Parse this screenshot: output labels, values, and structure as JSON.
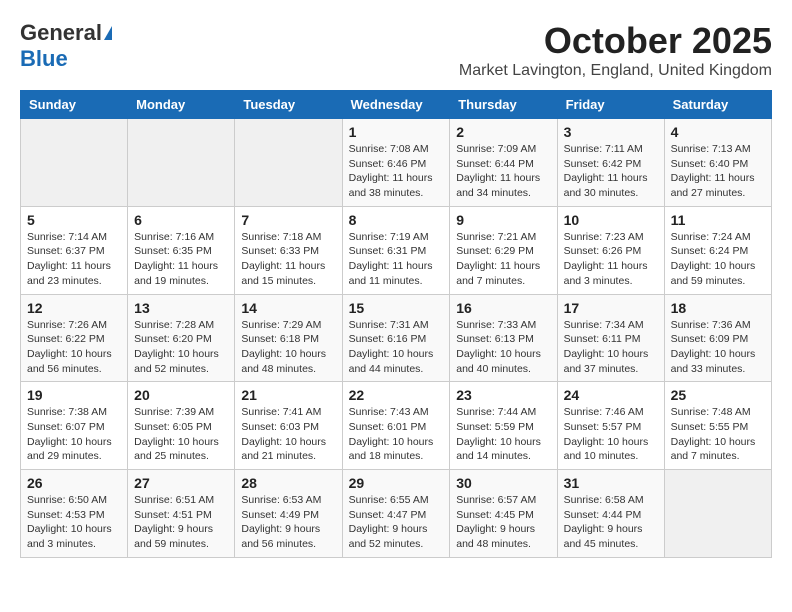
{
  "header": {
    "logo_general": "General",
    "logo_blue": "Blue",
    "month_title": "October 2025",
    "location": "Market Lavington, England, United Kingdom"
  },
  "weekdays": [
    "Sunday",
    "Monday",
    "Tuesday",
    "Wednesday",
    "Thursday",
    "Friday",
    "Saturday"
  ],
  "weeks": [
    [
      {
        "day": "",
        "info": ""
      },
      {
        "day": "",
        "info": ""
      },
      {
        "day": "",
        "info": ""
      },
      {
        "day": "1",
        "info": "Sunrise: 7:08 AM\nSunset: 6:46 PM\nDaylight: 11 hours\nand 38 minutes."
      },
      {
        "day": "2",
        "info": "Sunrise: 7:09 AM\nSunset: 6:44 PM\nDaylight: 11 hours\nand 34 minutes."
      },
      {
        "day": "3",
        "info": "Sunrise: 7:11 AM\nSunset: 6:42 PM\nDaylight: 11 hours\nand 30 minutes."
      },
      {
        "day": "4",
        "info": "Sunrise: 7:13 AM\nSunset: 6:40 PM\nDaylight: 11 hours\nand 27 minutes."
      }
    ],
    [
      {
        "day": "5",
        "info": "Sunrise: 7:14 AM\nSunset: 6:37 PM\nDaylight: 11 hours\nand 23 minutes."
      },
      {
        "day": "6",
        "info": "Sunrise: 7:16 AM\nSunset: 6:35 PM\nDaylight: 11 hours\nand 19 minutes."
      },
      {
        "day": "7",
        "info": "Sunrise: 7:18 AM\nSunset: 6:33 PM\nDaylight: 11 hours\nand 15 minutes."
      },
      {
        "day": "8",
        "info": "Sunrise: 7:19 AM\nSunset: 6:31 PM\nDaylight: 11 hours\nand 11 minutes."
      },
      {
        "day": "9",
        "info": "Sunrise: 7:21 AM\nSunset: 6:29 PM\nDaylight: 11 hours\nand 7 minutes."
      },
      {
        "day": "10",
        "info": "Sunrise: 7:23 AM\nSunset: 6:26 PM\nDaylight: 11 hours\nand 3 minutes."
      },
      {
        "day": "11",
        "info": "Sunrise: 7:24 AM\nSunset: 6:24 PM\nDaylight: 10 hours\nand 59 minutes."
      }
    ],
    [
      {
        "day": "12",
        "info": "Sunrise: 7:26 AM\nSunset: 6:22 PM\nDaylight: 10 hours\nand 56 minutes."
      },
      {
        "day": "13",
        "info": "Sunrise: 7:28 AM\nSunset: 6:20 PM\nDaylight: 10 hours\nand 52 minutes."
      },
      {
        "day": "14",
        "info": "Sunrise: 7:29 AM\nSunset: 6:18 PM\nDaylight: 10 hours\nand 48 minutes."
      },
      {
        "day": "15",
        "info": "Sunrise: 7:31 AM\nSunset: 6:16 PM\nDaylight: 10 hours\nand 44 minutes."
      },
      {
        "day": "16",
        "info": "Sunrise: 7:33 AM\nSunset: 6:13 PM\nDaylight: 10 hours\nand 40 minutes."
      },
      {
        "day": "17",
        "info": "Sunrise: 7:34 AM\nSunset: 6:11 PM\nDaylight: 10 hours\nand 37 minutes."
      },
      {
        "day": "18",
        "info": "Sunrise: 7:36 AM\nSunset: 6:09 PM\nDaylight: 10 hours\nand 33 minutes."
      }
    ],
    [
      {
        "day": "19",
        "info": "Sunrise: 7:38 AM\nSunset: 6:07 PM\nDaylight: 10 hours\nand 29 minutes."
      },
      {
        "day": "20",
        "info": "Sunrise: 7:39 AM\nSunset: 6:05 PM\nDaylight: 10 hours\nand 25 minutes."
      },
      {
        "day": "21",
        "info": "Sunrise: 7:41 AM\nSunset: 6:03 PM\nDaylight: 10 hours\nand 21 minutes."
      },
      {
        "day": "22",
        "info": "Sunrise: 7:43 AM\nSunset: 6:01 PM\nDaylight: 10 hours\nand 18 minutes."
      },
      {
        "day": "23",
        "info": "Sunrise: 7:44 AM\nSunset: 5:59 PM\nDaylight: 10 hours\nand 14 minutes."
      },
      {
        "day": "24",
        "info": "Sunrise: 7:46 AM\nSunset: 5:57 PM\nDaylight: 10 hours\nand 10 minutes."
      },
      {
        "day": "25",
        "info": "Sunrise: 7:48 AM\nSunset: 5:55 PM\nDaylight: 10 hours\nand 7 minutes."
      }
    ],
    [
      {
        "day": "26",
        "info": "Sunrise: 6:50 AM\nSunset: 4:53 PM\nDaylight: 10 hours\nand 3 minutes."
      },
      {
        "day": "27",
        "info": "Sunrise: 6:51 AM\nSunset: 4:51 PM\nDaylight: 9 hours\nand 59 minutes."
      },
      {
        "day": "28",
        "info": "Sunrise: 6:53 AM\nSunset: 4:49 PM\nDaylight: 9 hours\nand 56 minutes."
      },
      {
        "day": "29",
        "info": "Sunrise: 6:55 AM\nSunset: 4:47 PM\nDaylight: 9 hours\nand 52 minutes."
      },
      {
        "day": "30",
        "info": "Sunrise: 6:57 AM\nSunset: 4:45 PM\nDaylight: 9 hours\nand 48 minutes."
      },
      {
        "day": "31",
        "info": "Sunrise: 6:58 AM\nSunset: 4:44 PM\nDaylight: 9 hours\nand 45 minutes."
      },
      {
        "day": "",
        "info": ""
      }
    ]
  ]
}
